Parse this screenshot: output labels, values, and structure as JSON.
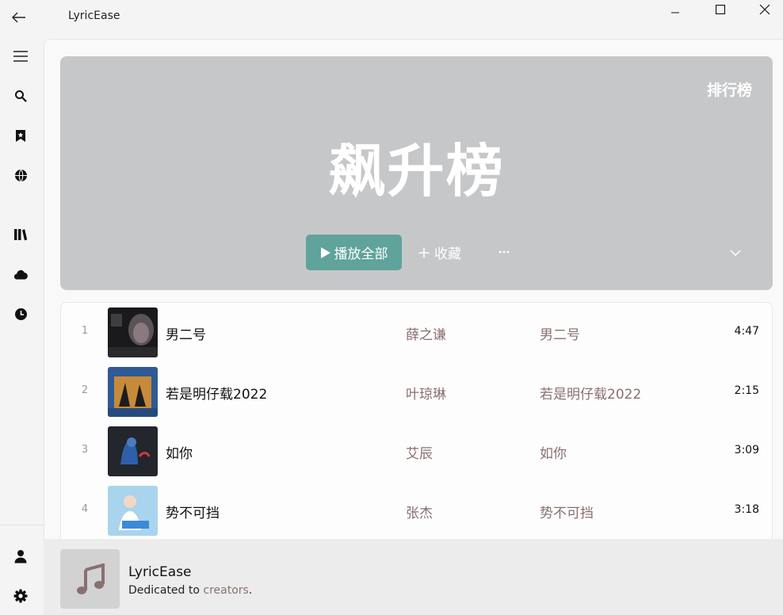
{
  "app": {
    "title": "LyricEase"
  },
  "window_controls": [
    "minimize-icon",
    "maximize-icon",
    "close-icon"
  ],
  "sidebar": {
    "top_items": [
      {
        "icon": "menu-icon"
      },
      {
        "icon": "search-icon"
      },
      {
        "icon": "bookmark-icon"
      },
      {
        "icon": "globe-icon"
      },
      {
        "icon": "library-icon"
      },
      {
        "icon": "cloud-icon"
      },
      {
        "icon": "clock-icon"
      }
    ],
    "bottom_items": [
      {
        "icon": "user-icon"
      },
      {
        "icon": "gear-icon"
      }
    ]
  },
  "hero": {
    "tag": "排行榜",
    "title": "飙升榜",
    "play_all_label": "播放全部",
    "favorite_label": "收藏",
    "more_label": "···",
    "bg_color": "#c6c7c9",
    "accent_color": "#5fa39a"
  },
  "songs": [
    {
      "index": "1",
      "title": "男二号",
      "artist": "薛之谦",
      "album": "男二号",
      "duration": "4:47"
    },
    {
      "index": "2",
      "title": "若是明仔载2022",
      "artist": "叶琼琳",
      "album": "若是明仔载2022",
      "duration": "2:15"
    },
    {
      "index": "3",
      "title": "如你",
      "artist": "艾辰",
      "album": "如你",
      "duration": "3:09"
    },
    {
      "index": "4",
      "title": "势不可挡",
      "artist": "张杰",
      "album": "势不可挡",
      "duration": "3:18"
    }
  ],
  "player": {
    "title": "LyricEase",
    "subtitle_prefix": "Dedicated to ",
    "subtitle_accent": "creators",
    "subtitle_suffix": "."
  }
}
